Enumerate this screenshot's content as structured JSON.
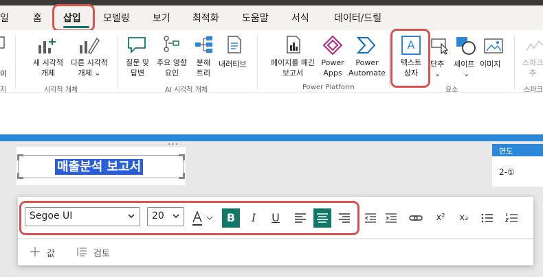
{
  "tabs": [
    {
      "label": "일"
    },
    {
      "label": "홈"
    },
    {
      "label": "삽입"
    },
    {
      "label": "모델링"
    },
    {
      "label": "보기"
    },
    {
      "label": "최적화"
    },
    {
      "label": "도움말"
    },
    {
      "label": "서식"
    },
    {
      "label": "데이터/드릴"
    }
  ],
  "ribbon": {
    "cut_left_top": "이",
    "cut_left_bottom": "지",
    "visuals": {
      "new_visual_1": "새 시각적",
      "new_visual_2": "개체",
      "other_visual_1": "다른 시각적",
      "other_visual_2": "개체 ⌄",
      "group_label": "시각적 개체"
    },
    "ai": {
      "qa_1": "질문 및",
      "qa_2": "답변",
      "key_1": "주요 영향",
      "key_2": "요인",
      "decomp_1": "분해",
      "decomp_2": "트리",
      "narrative": "내러티브",
      "group_label": "AI 시각적 개체"
    },
    "power_platform": {
      "paginated_1": "페이지를 매긴",
      "paginated_2": "보고서",
      "apps_1": "Power",
      "apps_2": "Apps",
      "automate_1": "Power",
      "automate_2": "Automate",
      "group_label": "Power Platform"
    },
    "elements": {
      "textbox_1": "텍스트",
      "textbox_2": "상자",
      "button": "단추",
      "shape": "셰이프",
      "image": "이미지",
      "chev": "⌄",
      "group_label": "요소"
    },
    "sparkline": {
      "line1": "스파크",
      "line2": "추",
      "group_label": "스파크"
    }
  },
  "canvas": {
    "dots": "···",
    "title": "매출분석 보고서",
    "table_header": "연도",
    "table_cell": "2-①"
  },
  "toolbar": {
    "font": "Segoe UI",
    "size": "20",
    "bold": "B",
    "italic": "I",
    "underline": "U",
    "superscript": "x²",
    "subscript": "x₂",
    "add_value": "값",
    "review": "검토"
  },
  "colors": {
    "accent": "#117865",
    "highlight": "#d9534f",
    "selection": "#2b5fd9",
    "canvas_bar": "#2b88d8"
  }
}
